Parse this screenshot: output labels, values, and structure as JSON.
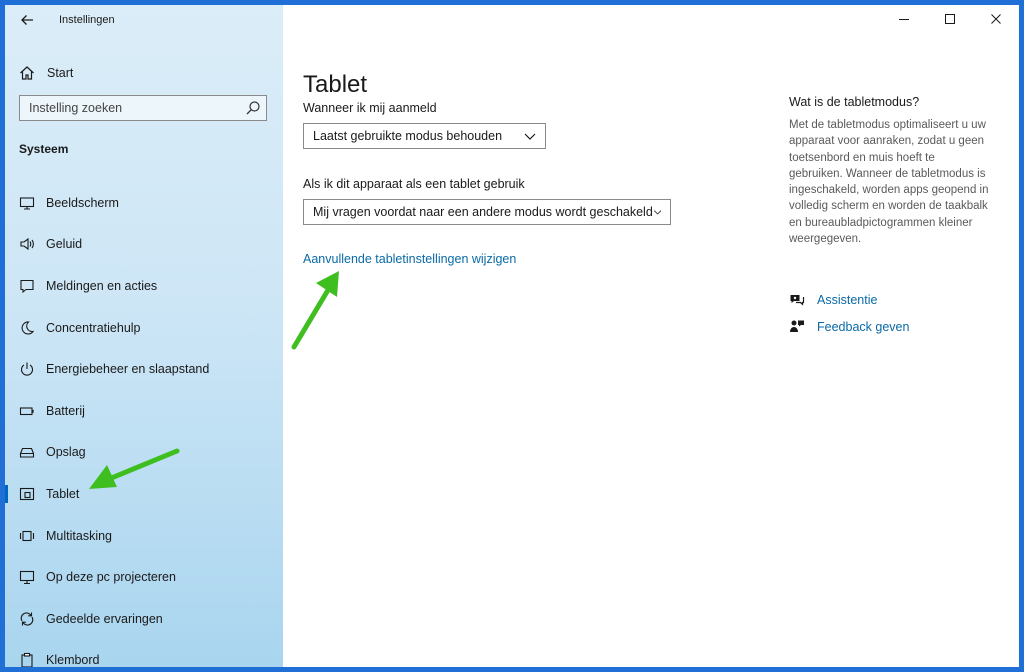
{
  "window": {
    "title": "Instellingen",
    "controls": [
      "minimize-icon",
      "maximize-icon",
      "close-icon"
    ]
  },
  "sidebar": {
    "home_label": "Start",
    "search_placeholder": "Instelling zoeken",
    "section_title": "Systeem",
    "selected": "Tablet",
    "items": [
      {
        "label": "Beeldscherm",
        "icon": "monitor-icon"
      },
      {
        "label": "Geluid",
        "icon": "speaker-icon"
      },
      {
        "label": "Meldingen en acties",
        "icon": "notification-icon"
      },
      {
        "label": "Concentratiehulp",
        "icon": "moon-icon"
      },
      {
        "label": "Energiebeheer en slaapstand",
        "icon": "power-icon"
      },
      {
        "label": "Batterij",
        "icon": "battery-icon"
      },
      {
        "label": "Opslag",
        "icon": "storage-icon"
      },
      {
        "label": "Tablet",
        "icon": "tablet-icon"
      },
      {
        "label": "Multitasking",
        "icon": "multitasking-icon"
      },
      {
        "label": "Op deze pc projecteren",
        "icon": "project-icon"
      },
      {
        "label": "Gedeelde ervaringen",
        "icon": "shared-experiences-icon"
      },
      {
        "label": "Klembord",
        "icon": "clipboard-icon"
      }
    ]
  },
  "main": {
    "title": "Tablet",
    "signin_label": "Wanneer ik mij aanmeld",
    "signin_value": "Laatst gebruikte modus behouden",
    "tablet_label": "Als ik dit apparaat als een tablet gebruik",
    "tablet_value": "Mij vragen voordat naar een andere modus wordt geschakeld",
    "extra_link": "Aanvullende tabletinstellingen wijzigen"
  },
  "aside": {
    "heading": "Wat is de tabletmodus?",
    "description": "Met de tabletmodus optimaliseert u uw apparaat voor aanraken, zodat u geen toetsenbord en muis hoeft te gebruiken. Wanneer de tabletmodus is ingeschakeld, worden apps geopend in volledig scherm en worden de taakbalk en bureaubladpictogrammen kleiner weergegeven.",
    "help_link": "Assistentie",
    "feedback_link": "Feedback geven"
  },
  "colors": {
    "accent": "#0067c0",
    "link": "#0b6aa7",
    "annotation_arrow": "#3fbf1f",
    "frame": "#1f6fd6"
  }
}
